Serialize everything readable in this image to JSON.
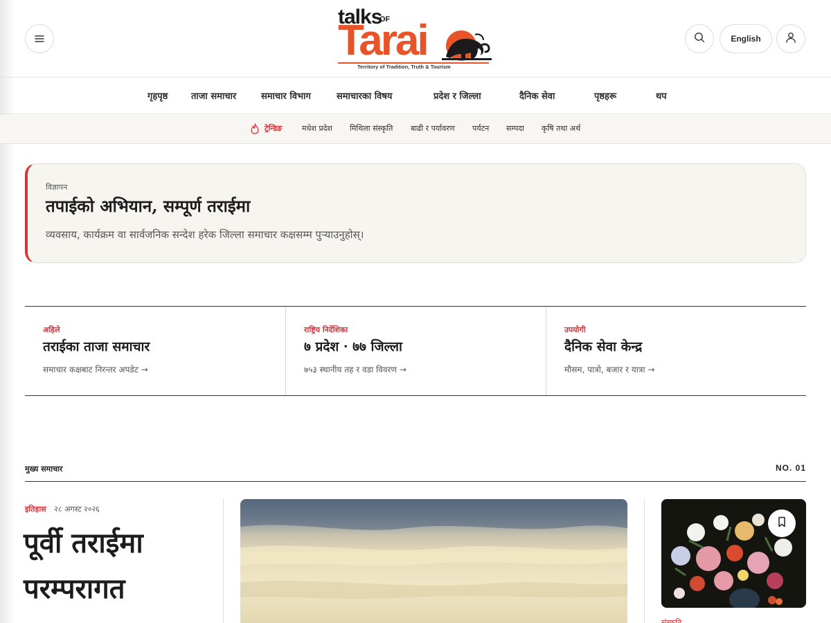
{
  "header": {
    "logo_text_top": "talks",
    "logo_text_of": "OF",
    "logo_text_main": "Tarai",
    "logo_tagline": "Territory of Tradition, Truth & Tourism",
    "lang_label": "English"
  },
  "icons": {
    "menu": "hamburger-icon",
    "search": "search-icon",
    "user": "user-icon",
    "trending": "flame-icon",
    "bookmark": "bookmark-icon"
  },
  "colors": {
    "accent": "#d6333a",
    "brand_orange": "#e8542a",
    "ad_background": "#f7f5ef",
    "secondary_nav_background": "#f7f6f2"
  },
  "primary_nav": [
    "गृहपृष्ठ",
    "ताजा समाचार",
    "समाचार विभाग",
    "समाचारका विषय",
    "प्रदेश र जिल्ला",
    "दैनिक सेवा",
    "पृष्ठहरू",
    "थप"
  ],
  "secondary_nav": {
    "trending_label": "ट्रेन्डिङ",
    "items": [
      "मधेश प्रदेश",
      "मिथिला संस्कृति",
      "बाढी र पर्यावरण",
      "पर्यटन",
      "सम्पदा",
      "कृषि तथा अर्थ"
    ]
  },
  "ad": {
    "tag": "विज्ञापन",
    "title": "तपाईको अभियान, सम्पूर्ण तराईमा",
    "description": "व्यवसाय, कार्यक्रम वा सार्वजनिक सन्देश हरेक जिल्ला समाचार कक्षसम्म पुऱ्याउनुहोस्।"
  },
  "cards": [
    {
      "kicker": "अहिले",
      "title": "तराईका ताजा समाचार",
      "link": "समाचार कक्षबाट निरन्तर अपडेट →"
    },
    {
      "kicker": "राष्ट्रिय निर्देशिका",
      "title": "७ प्रदेश · ७७ जिल्ला",
      "link": "७५३ स्थानीय तह र वडा विवरण →"
    },
    {
      "kicker": "उपयोगी",
      "title": "दैनिक सेवा केन्द्र",
      "link": "मौसम, पात्रो, बजार र यात्रा →"
    }
  ],
  "main_news": {
    "section_label": "मुख्य समाचार",
    "section_number": "NO. 01",
    "lead": {
      "category": "इतिहास",
      "date": "२८ अगस्ट २०२६",
      "title": "पूर्वी तराईमा परम्परागत"
    },
    "side": {
      "category": "संस्कृति"
    }
  }
}
